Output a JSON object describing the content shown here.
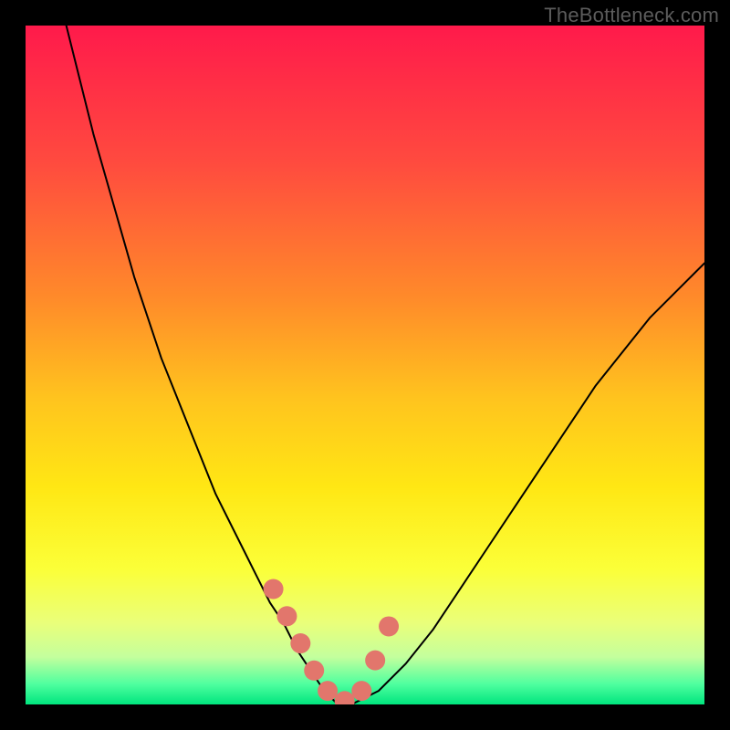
{
  "watermark": "TheBottleneck.com",
  "chart_data": {
    "type": "line",
    "title": "",
    "xlabel": "",
    "ylabel": "",
    "xlim": [
      0,
      100
    ],
    "ylim": [
      0,
      100
    ],
    "grid": false,
    "legend": false,
    "background_gradient": {
      "stops": [
        {
          "pct": 0,
          "color": "#ff1a4b"
        },
        {
          "pct": 20,
          "color": "#ff4a3f"
        },
        {
          "pct": 40,
          "color": "#ff8a2a"
        },
        {
          "pct": 55,
          "color": "#ffc41e"
        },
        {
          "pct": 68,
          "color": "#ffe714"
        },
        {
          "pct": 80,
          "color": "#fbff38"
        },
        {
          "pct": 88,
          "color": "#eaff7a"
        },
        {
          "pct": 93,
          "color": "#c4ff9d"
        },
        {
          "pct": 97,
          "color": "#4fff9f"
        },
        {
          "pct": 100,
          "color": "#00e57e"
        }
      ]
    },
    "series": [
      {
        "name": "bottleneck-curve",
        "color": "#000000",
        "stroke_width": 2,
        "x": [
          6,
          8,
          10,
          12,
          14,
          16,
          18,
          20,
          22,
          24,
          26,
          28,
          30,
          32,
          34,
          36,
          38,
          40,
          42,
          44,
          46,
          48,
          52,
          56,
          60,
          64,
          68,
          72,
          76,
          80,
          84,
          88,
          92,
          96,
          100
        ],
        "y": [
          100,
          92,
          84,
          77,
          70,
          63,
          57,
          51,
          46,
          41,
          36,
          31,
          27,
          23,
          19,
          15,
          12,
          8,
          5,
          2,
          0,
          0,
          2,
          6,
          11,
          17,
          23,
          29,
          35,
          41,
          47,
          52,
          57,
          61,
          65
        ]
      },
      {
        "name": "highlight-dots",
        "color": "#e2766c",
        "type": "scatter",
        "marker_radius": 11,
        "x": [
          36.5,
          38.5,
          40.5,
          42.5,
          44.5,
          47.0,
          49.5,
          51.5,
          53.5
        ],
        "y": [
          17.0,
          13.0,
          9.0,
          5.0,
          2.0,
          0.5,
          2.0,
          6.5,
          11.5
        ]
      }
    ]
  }
}
